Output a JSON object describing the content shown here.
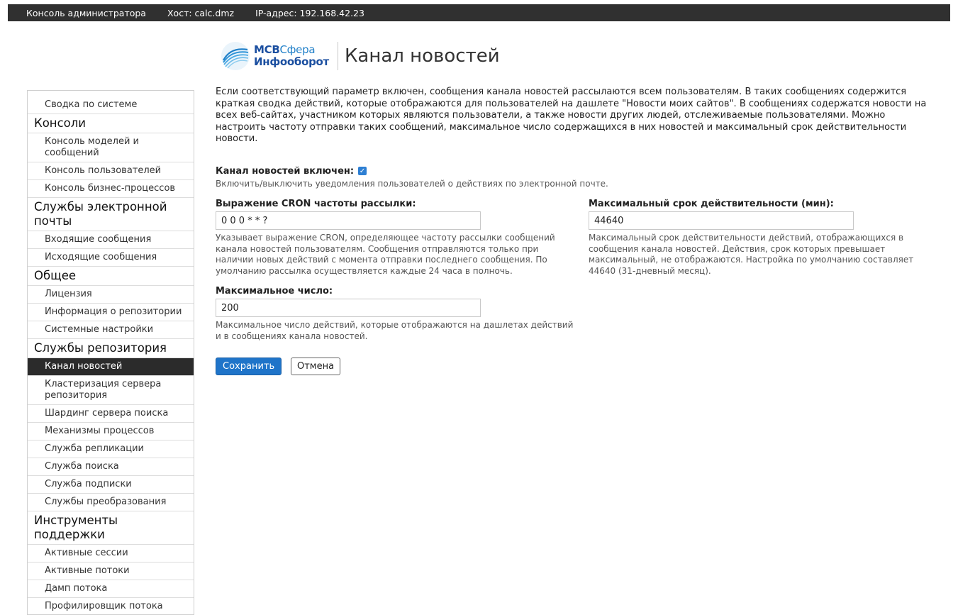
{
  "topbar": {
    "console_label": "Консоль администратора",
    "host": "Хост: calc.dmz",
    "ip": "IP-адрес: 192.168.42.23"
  },
  "brand": {
    "line1_a": "МСВ",
    "line1_b": "Сфера",
    "line2": "Инфооборот"
  },
  "page": {
    "title": "Канал новостей"
  },
  "sidebar": {
    "items": [
      {
        "type": "item",
        "label": "Сводка по системе"
      },
      {
        "type": "head",
        "label": "Консоли"
      },
      {
        "type": "item",
        "label": "Консоль моделей и сообщений"
      },
      {
        "type": "item",
        "label": "Консоль пользователей"
      },
      {
        "type": "item",
        "label": "Консоль бизнес-процессов"
      },
      {
        "type": "head",
        "label": "Службы электронной почты"
      },
      {
        "type": "item",
        "label": "Входящие сообщения"
      },
      {
        "type": "item",
        "label": "Исходящие сообщения"
      },
      {
        "type": "head",
        "label": "Общее"
      },
      {
        "type": "item",
        "label": "Лицензия"
      },
      {
        "type": "item",
        "label": "Информация о репозитории"
      },
      {
        "type": "item",
        "label": "Системные настройки"
      },
      {
        "type": "head",
        "label": "Службы репозитория"
      },
      {
        "type": "item",
        "label": "Канал новостей",
        "active": true
      },
      {
        "type": "item",
        "label": "Кластеризация сервера репозитория"
      },
      {
        "type": "item",
        "label": "Шардинг сервера поиска"
      },
      {
        "type": "item",
        "label": "Механизмы процессов"
      },
      {
        "type": "item",
        "label": "Служба репликации"
      },
      {
        "type": "item",
        "label": "Служба поиска"
      },
      {
        "type": "item",
        "label": "Служба подписки"
      },
      {
        "type": "item",
        "label": "Службы преобразования"
      },
      {
        "type": "head",
        "label": "Инструменты поддержки"
      },
      {
        "type": "item",
        "label": "Активные сессии"
      },
      {
        "type": "item",
        "label": "Активные потоки"
      },
      {
        "type": "item",
        "label": "Дамп потока"
      },
      {
        "type": "item",
        "label": "Профилировщик потока"
      }
    ]
  },
  "main": {
    "description": "Если соответствующий параметр включен, сообщения канала новостей рассылаются всем пользователям. В таких сообщениях содержится краткая сводка действий, которые отображаются для пользователей на дашлете \"Новости моих сайтов\". В сообщениях содержатся новости на всех веб-сайтах, участником которых являются пользователи, а также новости других людей, отслеживаемые пользователями. Можно настроить частоту отправки таких сообщений, максимальное число содержащихся в них новостей и максимальный срок действительности новости.",
    "enabled_label": "Канал новостей включен:",
    "enabled": true,
    "enabled_hint": "Включить/выключить уведомления пользователей о действиях по электронной почте.",
    "cron_label": "Выражение CRON частоты рассылки:",
    "cron_value": "0 0 0 * * ?",
    "cron_hint": "Указывает выражение CRON, определяющее частоту рассылки сообщений канала новостей пользователям. Сообщения отправляются только при наличии новых действий с момента отправки последнего сообщения. По умолчанию рассылка осуществляется каждые 24 часа в полночь.",
    "max_age_label": "Максимальный срок действительности (мин):",
    "max_age_value": "44640",
    "max_age_hint": "Максимальный срок действительности действий, отображающихся в сообщения канала новостей. Действия, срок которых превышает максимальный, не отображаются. Настройка по умолчанию составляет 44640 (31-дневный месяц).",
    "max_count_label": "Максимальное число:",
    "max_count_value": "200",
    "max_count_hint": "Максимальное число действий, которые отображаются на дашлетах действий и в сообщениях канала новостей.",
    "save_label": "Сохранить",
    "cancel_label": "Отмена"
  }
}
